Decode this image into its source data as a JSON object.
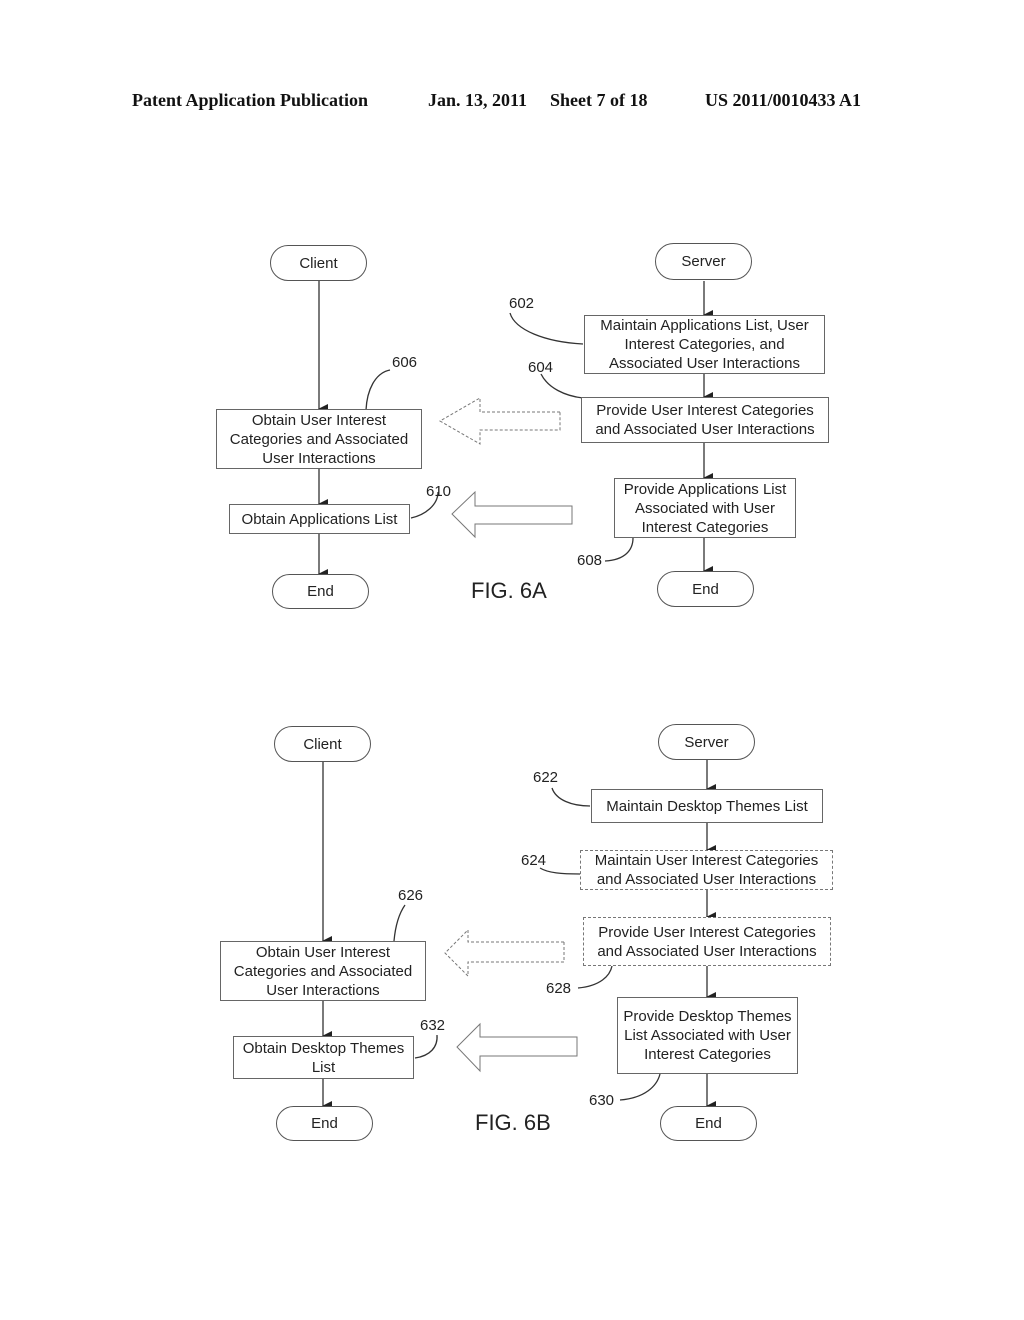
{
  "header": {
    "publication": "Patent Application Publication",
    "date": "Jan. 13, 2011",
    "sheet": "Sheet 7 of 18",
    "number": "US 2011/0010433 A1"
  },
  "fig6a": {
    "label": "FIG. 6A",
    "client": {
      "start": "Client",
      "obtain_categories": "Obtain User Interest Categories and Associated User Interactions",
      "obtain_apps": "Obtain Applications List",
      "end": "End"
    },
    "server": {
      "start": "Server",
      "maintain": "Maintain Applications List, User Interest Categories, and Associated User Interactions",
      "provide_categories": "Provide User Interest Categories and Associated User Interactions",
      "provide_apps": "Provide Applications List Associated with User Interest Categories",
      "end": "End"
    },
    "refs": {
      "r602": "602",
      "r604": "604",
      "r606": "606",
      "r608": "608",
      "r610": "610"
    }
  },
  "fig6b": {
    "label": "FIG. 6B",
    "client": {
      "start": "Client",
      "obtain_categories": "Obtain User Interest Categories and Associated User Interactions",
      "obtain_themes": "Obtain Desktop Themes List",
      "end": "End"
    },
    "server": {
      "start": "Server",
      "maintain_themes": "Maintain Desktop Themes List",
      "maintain_categories": "Maintain User Interest Categories and Associated User Interactions",
      "provide_categories": "Provide User Interest Categories and Associated User Interactions",
      "provide_themes": "Provide Desktop Themes List Associated with User Interest Categories",
      "end": "End"
    },
    "refs": {
      "r622": "622",
      "r624": "624",
      "r626": "626",
      "r628": "628",
      "r630": "630",
      "r632": "632"
    }
  }
}
